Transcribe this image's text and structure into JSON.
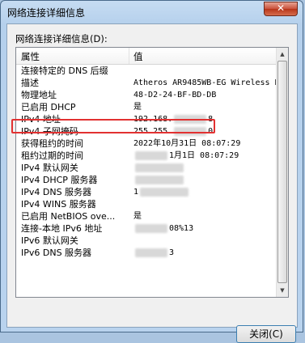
{
  "window": {
    "title": "网络连接详细信息",
    "close_glyph": "✕"
  },
  "group_label": "网络连接详细信息(D):",
  "columns": {
    "property": "属性",
    "value": "值"
  },
  "rows": [
    {
      "k": "连接特定的 DNS 后缀",
      "v": ""
    },
    {
      "k": "描述",
      "v": "Atheros AR9485WB-EG Wireless N"
    },
    {
      "k": "物理地址",
      "v": "48-D2-24-BF-BD-DB"
    },
    {
      "k": "已启用 DHCP",
      "v": "是"
    },
    {
      "k": "IPv4 地址",
      "v": "192.168.",
      "blur": true,
      "v2": "8"
    },
    {
      "k": "IPv4 子网掩码",
      "v": "255.255.",
      "blur": true,
      "v2": "0"
    },
    {
      "k": "获得租约的时间",
      "v": "2022年10月31日 08:07:29"
    },
    {
      "k": "租约过期的时间",
      "v": "",
      "blur": true,
      "v2": "1月1日 08:07:29"
    },
    {
      "k": "IPv4 默认网关",
      "v": "",
      "blur": true
    },
    {
      "k": "IPv4 DHCP 服务器",
      "v": "",
      "blur": true
    },
    {
      "k": "IPv4 DNS 服务器",
      "v": "1",
      "blur": true
    },
    {
      "k": "IPv4 WINS 服务器",
      "v": ""
    },
    {
      "k": "已启用 NetBIOS ove...",
      "v": "是"
    },
    {
      "k": "连接-本地 IPv6 地址",
      "v": "",
      "blur": true,
      "v2": "08%13"
    },
    {
      "k": "IPv6 默认网关",
      "v": ""
    },
    {
      "k": "IPv6 DNS 服务器",
      "v": "",
      "blur": true,
      "v2": "3"
    }
  ],
  "close_button_label": "关闭(C)"
}
